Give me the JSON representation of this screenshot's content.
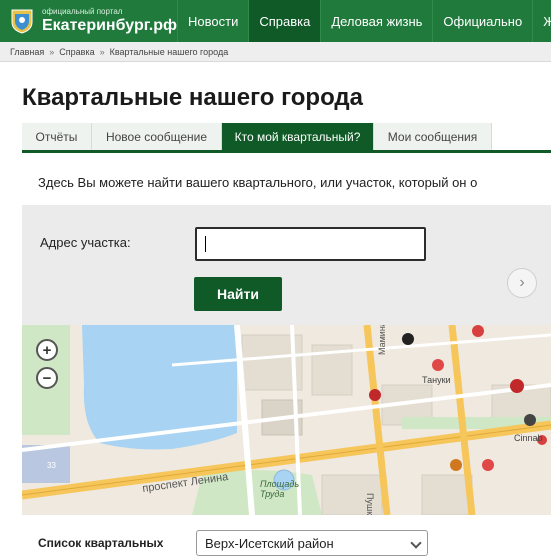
{
  "header": {
    "logo_small": "официальный портал",
    "logo_big": "Екатеринбург.рф",
    "nav": [
      {
        "label": "Новости"
      },
      {
        "label": "Справка"
      },
      {
        "label": "Деловая жизнь"
      },
      {
        "label": "Официально"
      },
      {
        "label": "Жител"
      }
    ],
    "active_nav": "Справка"
  },
  "breadcrumb": [
    "Главная",
    "Справка",
    "Квартальные нашего города"
  ],
  "page": {
    "title": "Квартальные нашего города",
    "tabs": [
      {
        "label": "Отчёты"
      },
      {
        "label": "Новое сообщение"
      },
      {
        "label": "Кто мой квартальный?"
      },
      {
        "label": "Мои сообщения"
      }
    ],
    "active_tab": "Кто мой квартальный?",
    "intro": "Здесь Вы можете найти вашего квартального, или участок, который он о"
  },
  "search": {
    "address_label": "Адрес участка:",
    "address_value": "",
    "find_label": "Найти"
  },
  "map": {
    "zoom_in": "+",
    "zoom_out": "−",
    "labels": {
      "lenina": "проспект Ленина",
      "square": "Площадь\nТруда",
      "pushk": "Пушк",
      "mamina": "Мамина",
      "tanuki": "Тануки",
      "cinnabon": "Cinnab",
      "house": "33"
    }
  },
  "list": {
    "label": "Список квартальных",
    "selected": "Верх-Исетский район"
  },
  "colors": {
    "brand_green": "#1f7a3c",
    "dark_green": "#0f5a26",
    "water": "#a9d3f2",
    "road": "#f6c65a"
  }
}
